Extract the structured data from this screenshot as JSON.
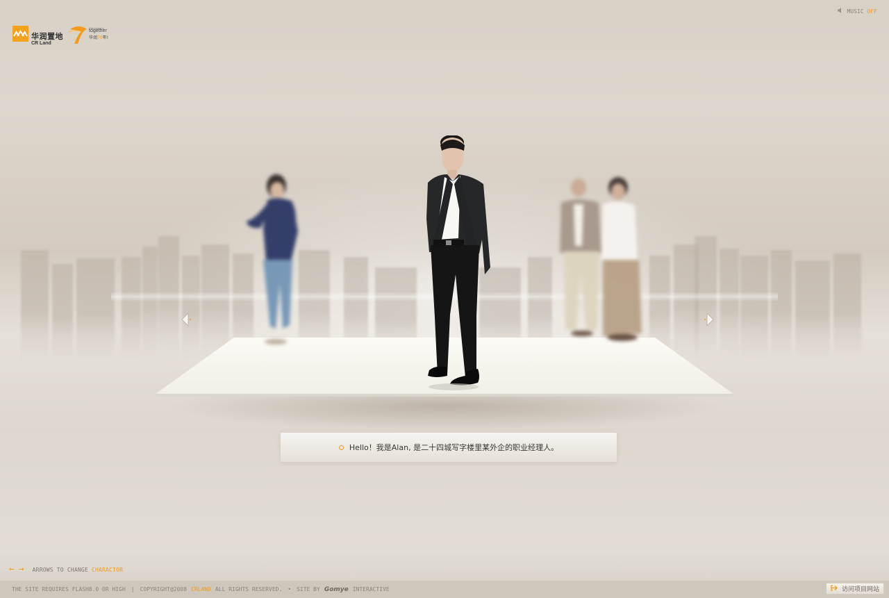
{
  "header": {
    "logo_cn": "华润置地",
    "logo_en": "CR Land",
    "anniv_small": "Harmony by",
    "anniv_together": "together",
    "anniv_cn_prefix": "华润",
    "anniv_cn_highlight": "70",
    "anniv_cn_suffix": "年!",
    "music_label": "MUSIC",
    "music_state": "OFF"
  },
  "stage": {
    "left_arrow_icon": "chevron-left-icon",
    "right_arrow_icon": "chevron-right-icon",
    "current_character": "Alan"
  },
  "dialog": {
    "text": "Hello！我是Alan, 是二十四城写字楼里某外企的职业经理人。"
  },
  "hint": {
    "left_arrow": "←",
    "right_arrow": "→",
    "label_prefix": "ARROWS TO CHANGE",
    "label_highlight": "CHARACTOR"
  },
  "footer": {
    "requires": "THE SITE REQUIRES FLASH8.0 OR HIGH",
    "separator": "|",
    "copyright": "COPYRIGHT@2008",
    "brand": "CRLAND",
    "rights": "ALL RIGHTS RESERVED.",
    "bullet": "•",
    "site_by": "SITE BY",
    "agency": "Gomye",
    "interactive": "INTERACTIVE",
    "visit_button": "访问项目网站"
  },
  "colors": {
    "accent": "#f29a1c",
    "background": "#ddd6cc",
    "footer_bar": "#cec7bc"
  }
}
